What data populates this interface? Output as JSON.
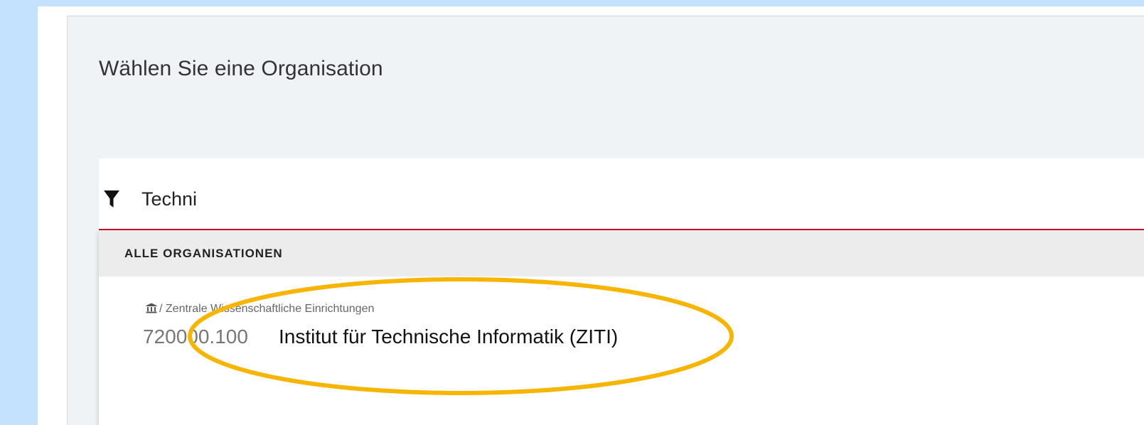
{
  "dialog": {
    "title": "Wählen Sie eine Organisation"
  },
  "filter": {
    "value": "Techni",
    "icon": "filter-icon"
  },
  "results": {
    "section_label": "ALLE ORGANISATIONEN",
    "items": [
      {
        "path_icon": "institution-icon",
        "path": "/ Zentrale Wissenschaftliche Einrichtungen",
        "code": "720000.100",
        "name": "Institut für Technische Informatik (ZITI)"
      }
    ]
  },
  "colors": {
    "background": "#c4e2fd",
    "panel": "#f0f3f5",
    "accent_line": "#c8102e",
    "highlight": "#f7b500"
  }
}
